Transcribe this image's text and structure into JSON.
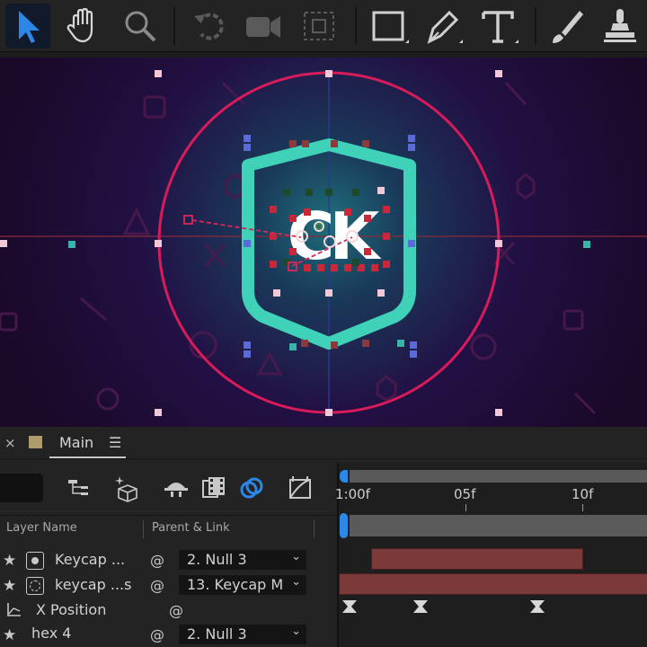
{
  "toolbar": {
    "tools": [
      {
        "icon": "selection-arrow-icon",
        "active": true
      },
      {
        "icon": "hand-icon"
      },
      {
        "icon": "zoom-icon"
      },
      {
        "icon": "rotate-icon"
      },
      {
        "icon": "camera-icon"
      },
      {
        "icon": "pan-behind-icon"
      },
      {
        "icon": "rectangle-tool-icon"
      },
      {
        "icon": "pen-tool-icon"
      },
      {
        "icon": "type-tool-icon"
      },
      {
        "icon": "brush-tool-icon"
      },
      {
        "icon": "clone-stamp-icon"
      }
    ]
  },
  "panel": {
    "tab": {
      "close": "×",
      "label": "Main",
      "menu": "☰"
    },
    "columns": {
      "layer_name": "Layer Name",
      "parent_link": "Parent & Link"
    },
    "layers": [
      {
        "name": "Keycap ...",
        "parent": "2. Null 3",
        "has_star": true
      },
      {
        "name": "keycap ...s",
        "parent": "13. Keycap M",
        "has_star": true
      },
      {
        "name": "X Position",
        "is_property": true
      },
      {
        "name": "hex 4",
        "parent": "2. Null 3",
        "has_star": true
      }
    ],
    "chevron": "⌄"
  },
  "timeline": {
    "ticks": [
      {
        "label": "1:00f"
      },
      {
        "label": "05f"
      },
      {
        "label": "10f"
      }
    ]
  },
  "colors": {
    "accent": "#2d87e6",
    "shield": "#3fd2b8",
    "circle": "#d81b5a",
    "layer_bar": "#7a3a3a",
    "background": "#1a0a2a"
  }
}
